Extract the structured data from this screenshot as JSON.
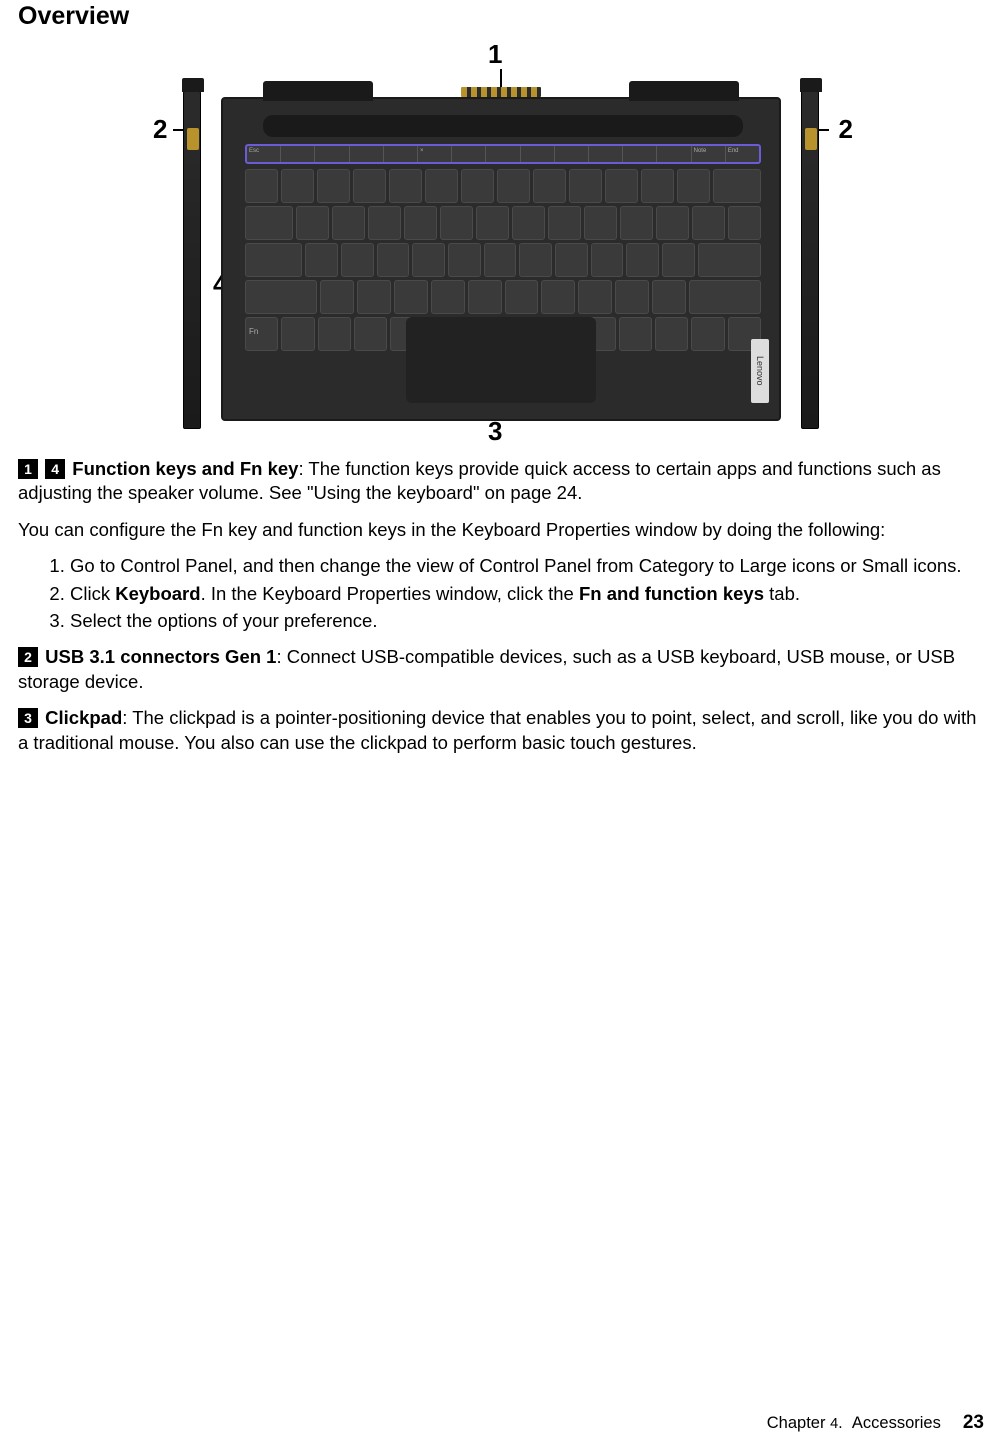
{
  "heading": "Overview",
  "figure": {
    "callouts": {
      "c1": "1",
      "c2": "2",
      "c3": "3",
      "c4": "4"
    },
    "brand": "Lenovo",
    "fn_labels": [
      "Esc",
      "",
      "",
      "",
      "",
      "×",
      "",
      "",
      "",
      "",
      "",
      "",
      "",
      "Note",
      "End"
    ],
    "fn_inside_label": "Fn"
  },
  "p1": {
    "badge1": "1",
    "badge2": "4",
    "title": "Function keys and Fn key",
    "text": ": The function keys provide quick access to certain apps and functions such as adjusting the speaker volume. See \"Using the keyboard\" on page 24."
  },
  "p2": "You can configure the Fn key and function keys in the Keyboard Properties window by doing the following:",
  "steps": {
    "s1": "Go to Control Panel, and then change the view of Control Panel from Category to Large icons or Small icons.",
    "s2a": "Click ",
    "s2b": "Keyboard",
    "s2c": ". In the Keyboard Properties window, click the ",
    "s2d": "Fn and function keys",
    "s2e": " tab.",
    "s3": "Select the options of your preference."
  },
  "p3": {
    "badge": "2",
    "title": "USB 3.1 connectors Gen 1",
    "text": ": Connect USB-compatible devices, such as a USB keyboard, USB mouse, or USB storage device."
  },
  "p4": {
    "badge": "3",
    "title": "Clickpad",
    "text": ": The clickpad is a pointer-positioning device that enables you to point, select, and scroll, like you do with a traditional mouse. You also can use the clickpad to perform basic touch gestures."
  },
  "footer": {
    "chapter_word": "Chapter",
    "chapter_num": "4",
    "dot": ".",
    "section": "Accessories",
    "page": "23"
  }
}
